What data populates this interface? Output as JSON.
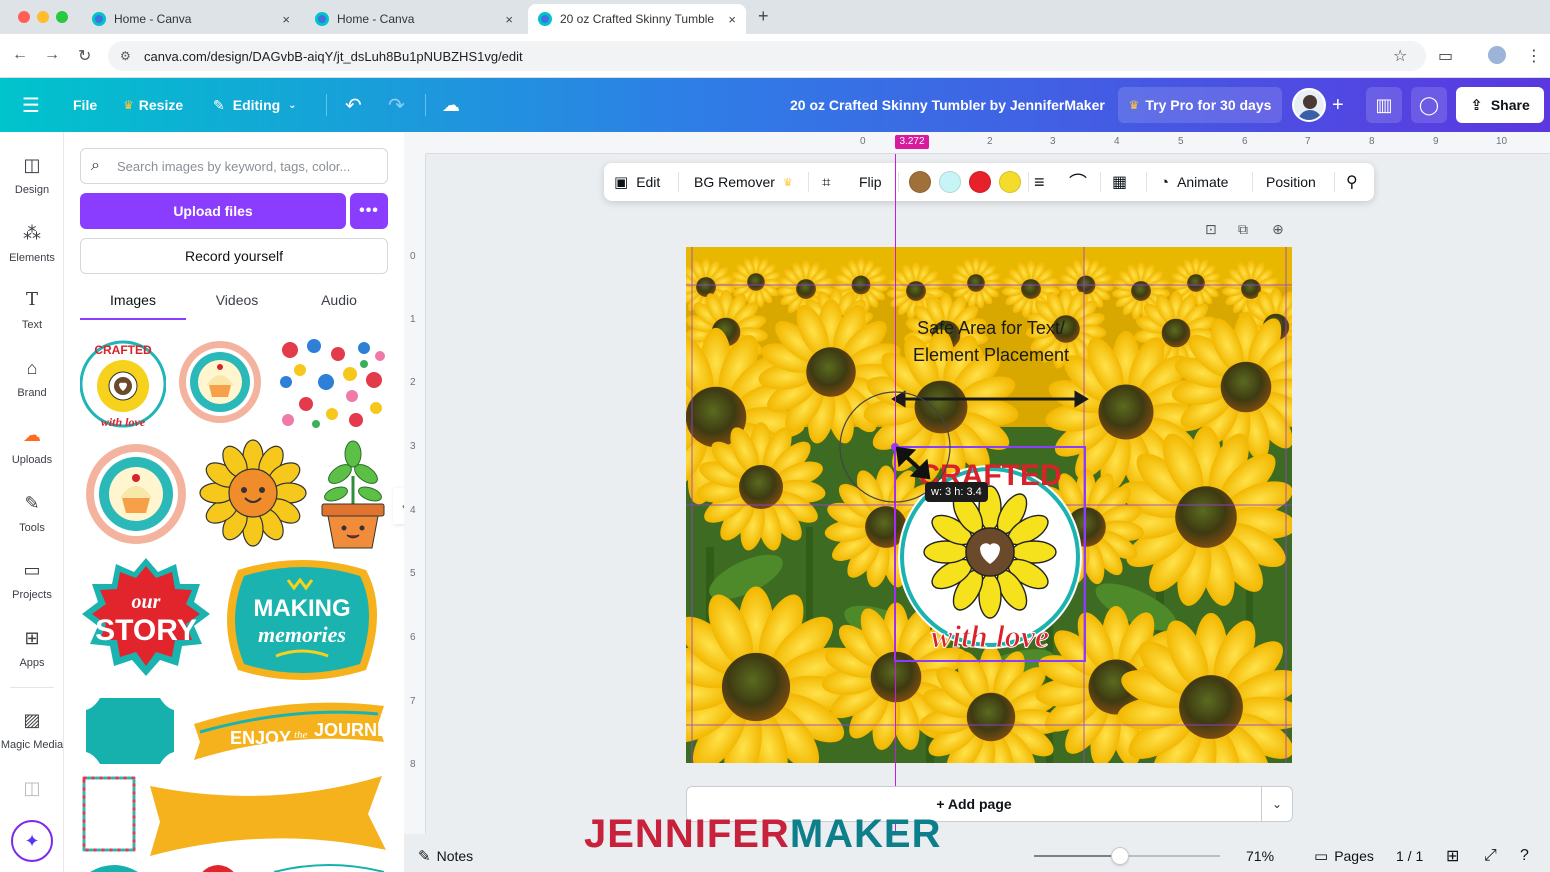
{
  "browser": {
    "tabs": [
      {
        "title": "Home - Canva",
        "active": false
      },
      {
        "title": "Home - Canva",
        "active": false
      },
      {
        "title": "20 oz Crafted Skinny Tumble",
        "active": true
      }
    ],
    "new_tab": "+",
    "close": "×",
    "url": "canva.com/design/DAGvbB-aiqY/jt_dsLuh8Bu1pNUBZHS1vg/edit"
  },
  "header": {
    "file": "File",
    "resize": "Resize",
    "editing": "Editing",
    "design_title": "20 oz Crafted Skinny Tumbler by JenniferMaker",
    "try_pro": "Try Pro for 30 days",
    "share": "Share",
    "gradient": [
      "#00c4cc",
      "#2f7de6",
      "#5b37e0"
    ]
  },
  "rail": {
    "items": [
      {
        "label": "Design",
        "icon": "design-icon"
      },
      {
        "label": "Elements",
        "icon": "elements-icon"
      },
      {
        "label": "Text",
        "icon": "text-icon"
      },
      {
        "label": "Brand",
        "icon": "brand-icon"
      },
      {
        "label": "Uploads",
        "icon": "uploads-icon"
      },
      {
        "label": "Tools",
        "icon": "tools-icon"
      },
      {
        "label": "Projects",
        "icon": "projects-icon"
      },
      {
        "label": "Apps",
        "icon": "apps-icon"
      },
      {
        "label": "Magic Media",
        "icon": "magic-media-icon"
      }
    ],
    "active": "Uploads"
  },
  "panel": {
    "search_placeholder": "Search images by keyword, tags, color...",
    "upload_files": "Upload files",
    "more": "•••",
    "record_yourself": "Record yourself",
    "tabs": [
      "Images",
      "Videos",
      "Audio"
    ],
    "active_tab": "Images",
    "thumbnails": {
      "crafted_top": "CRAFTED",
      "crafted_bottom": "with love",
      "our": "our",
      "story": "STORY",
      "making": "MAKING",
      "memories": "memories",
      "enjoy": "ENJOY",
      "the": "the",
      "journey": "JOURNEY"
    }
  },
  "ruler": {
    "h_ticks": [
      "0",
      "2",
      "3",
      "4",
      "5",
      "6",
      "7",
      "8",
      "9",
      "10"
    ],
    "v_ticks": [
      "0",
      "1",
      "2",
      "3",
      "4",
      "5",
      "6",
      "7",
      "8"
    ],
    "marker": "3.272"
  },
  "context_toolbar": {
    "edit": "Edit",
    "bg_remover": "BG Remover",
    "flip": "Flip",
    "colors": [
      "#a0703a",
      "#c7f5f7",
      "#e8202a",
      "#f3dc2b"
    ],
    "animate": "Animate",
    "position": "Position"
  },
  "canvas": {
    "safe_area_text": "Safe Area for Text/ Element Placement",
    "sticker_top": "CRAFTED",
    "sticker_bottom": "with love",
    "size_tooltip": "w: 3 h: 3.4",
    "add_page": "+ Add page"
  },
  "bottom_bar": {
    "notes": "Notes",
    "zoom": "71%",
    "zoom_level": 0.46,
    "pages": "Pages",
    "page_count": "1 / 1"
  },
  "watermark": {
    "part1": "JENNIFER",
    "part2": "MAKER"
  }
}
